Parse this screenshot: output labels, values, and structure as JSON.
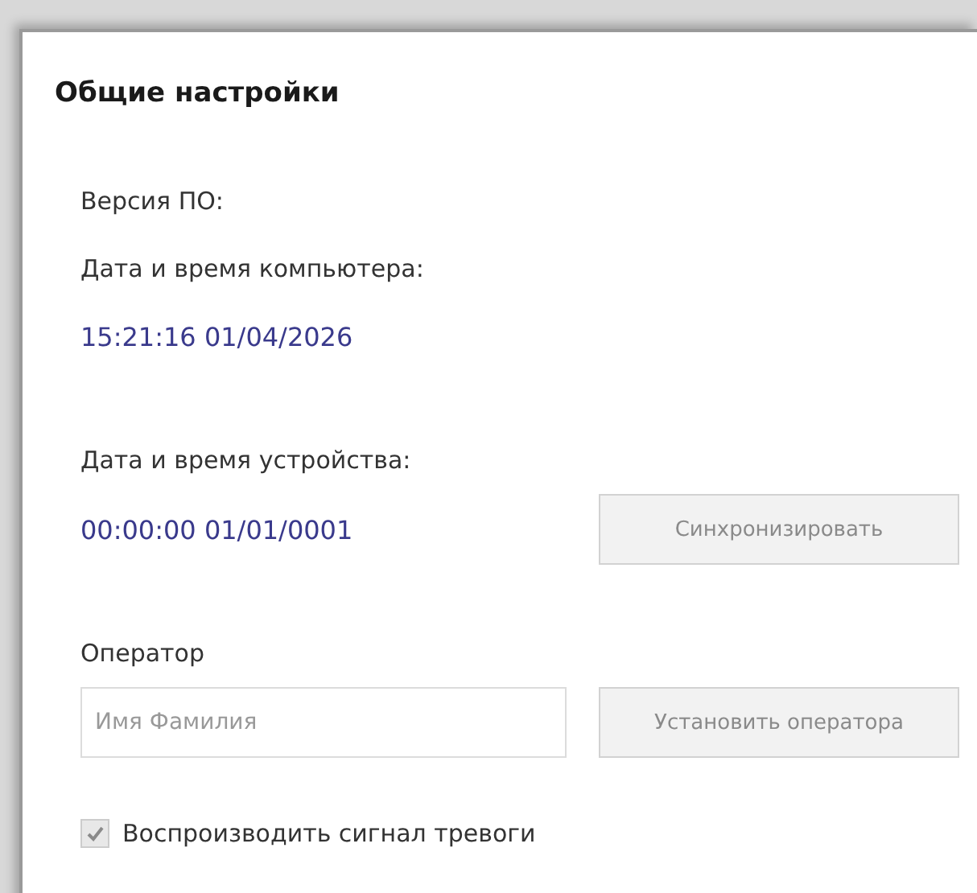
{
  "panel": {
    "title": "Общие настройки"
  },
  "software_version": {
    "label": "Версия ПО:"
  },
  "computer_time": {
    "label": "Дата и время компьютера:",
    "value": "15:21:16 01/04/2026"
  },
  "device_time": {
    "label": "Дата и время устройства:",
    "value": "00:00:00 01/01/0001",
    "button": {
      "label": "Синхронизировать",
      "disabled": true
    }
  },
  "operator": {
    "label": "Оператор",
    "placeholder": "Имя Фамилия",
    "button": {
      "label": "Установить оператора",
      "disabled": true
    }
  },
  "alarm_sound": {
    "label": "Воспроизводить сигнал тревоги",
    "checked": true,
    "disabled": true
  }
}
